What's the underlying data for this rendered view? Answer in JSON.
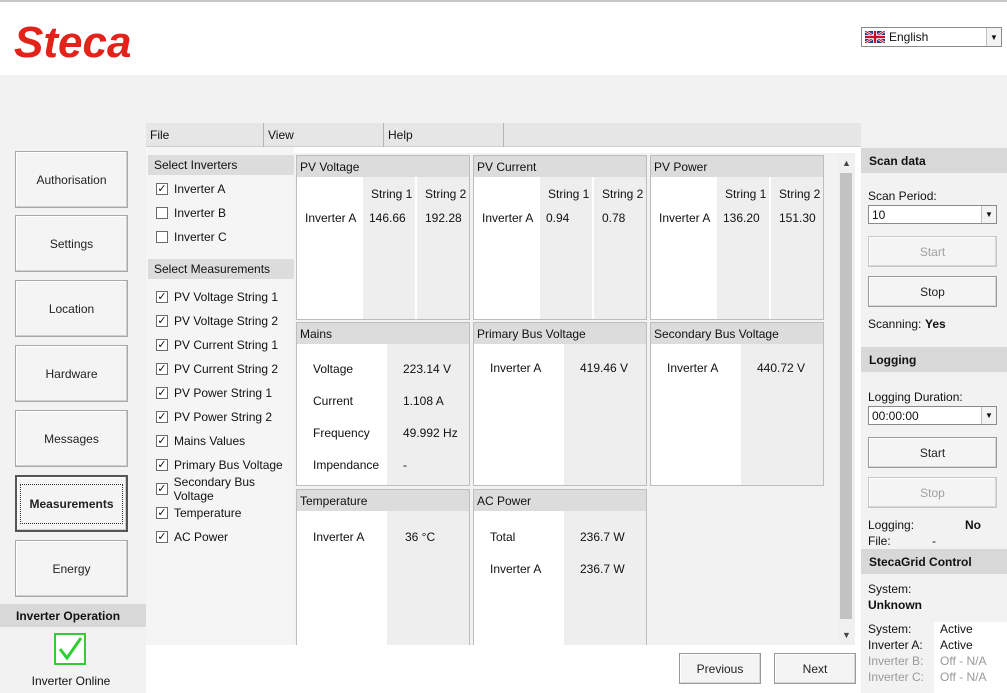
{
  "brand": {
    "logo_text": "Steca",
    "color": "#e2231a"
  },
  "language": {
    "selected": "English"
  },
  "nav": {
    "buttons": [
      "Authorisation",
      "Settings",
      "Location",
      "Hardware",
      "Messages",
      "Measurements",
      "Energy"
    ],
    "active": "Measurements"
  },
  "operation": {
    "header": "Inverter Operation",
    "status": "Inverter Online"
  },
  "menu": {
    "file": "File",
    "view": "View",
    "help": "Help"
  },
  "select_inverters": {
    "header": "Select Inverters",
    "items": [
      {
        "label": "Inverter A",
        "checked": true
      },
      {
        "label": "Inverter B",
        "checked": false
      },
      {
        "label": "Inverter C",
        "checked": false
      }
    ]
  },
  "select_measurements": {
    "header": "Select Measurements",
    "items": [
      {
        "label": "PV Voltage String 1",
        "checked": true
      },
      {
        "label": "PV Voltage String 2",
        "checked": true
      },
      {
        "label": "PV Current String 1",
        "checked": true
      },
      {
        "label": "PV Current String 2",
        "checked": true
      },
      {
        "label": "PV Power String 1",
        "checked": true
      },
      {
        "label": "PV Power String 2",
        "checked": true
      },
      {
        "label": "Mains Values",
        "checked": true
      },
      {
        "label": "Primary Bus Voltage",
        "checked": true
      },
      {
        "label": "Secondary Bus Voltage",
        "checked": true
      },
      {
        "label": "Temperature",
        "checked": true
      },
      {
        "label": "AC Power",
        "checked": true
      }
    ]
  },
  "cards": {
    "pv_voltage": {
      "title": "PV Voltage",
      "col1": "String 1",
      "col2": "String 2",
      "row": "Inverter A",
      "v1": "146.66",
      "v2": "192.28"
    },
    "pv_current": {
      "title": "PV Current",
      "col1": "String 1",
      "col2": "String 2",
      "row": "Inverter A",
      "v1": "0.94",
      "v2": "0.78"
    },
    "pv_power": {
      "title": "PV Power",
      "col1": "String 1",
      "col2": "String 2",
      "row": "Inverter A",
      "v1": "136.20",
      "v2": "151.30"
    },
    "mains": {
      "title": "Mains",
      "rows": [
        {
          "label": "Voltage",
          "value": "223.14 V"
        },
        {
          "label": "Current",
          "value": "1.108 A"
        },
        {
          "label": "Frequency",
          "value": "49.992 Hz"
        },
        {
          "label": "Impendance",
          "value": "-"
        }
      ]
    },
    "primary_bus": {
      "title": "Primary Bus Voltage",
      "label": "Inverter A",
      "value": "419.46 V"
    },
    "secondary_bus": {
      "title": "Secondary Bus Voltage",
      "label": "Inverter A",
      "value": "440.72 V"
    },
    "temperature": {
      "title": "Temperature",
      "label": "Inverter A",
      "value": "36 °C"
    },
    "ac_power": {
      "title": "AC Power",
      "rows": [
        {
          "label": "Total",
          "value": "236.7 W"
        },
        {
          "label": "Inverter A",
          "value": "236.7 W"
        }
      ]
    }
  },
  "pager": {
    "previous": "Previous",
    "next": "Next"
  },
  "scan": {
    "header": "Scan data",
    "period_label": "Scan Period:",
    "period_value": "10",
    "start": "Start",
    "stop": "Stop",
    "scanning_label": "Scanning:",
    "scanning_value": "Yes"
  },
  "logging": {
    "header": "Logging",
    "duration_label": "Logging Duration:",
    "duration_value": "00:00:00",
    "start": "Start",
    "stop": "Stop",
    "logging_label": "Logging:",
    "logging_value": "No",
    "file_label": "File:",
    "file_value": "-"
  },
  "stecagrid": {
    "header": "StecaGrid Control",
    "system_label": "System:",
    "system_value": "Unknown",
    "status_rows": [
      {
        "label": "System:",
        "value": "Active"
      },
      {
        "label": "Inverter A:",
        "value": "Active"
      },
      {
        "label": "Inverter B:",
        "value": "Off - N/A"
      },
      {
        "label": "Inverter C:",
        "value": "Off - N/A"
      }
    ]
  }
}
